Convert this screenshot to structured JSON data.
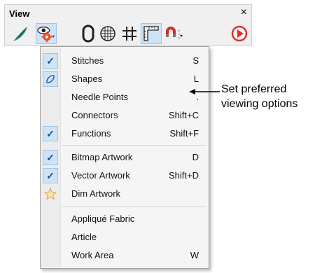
{
  "toolbar": {
    "title": "View",
    "close": "×",
    "buttons": [
      {
        "icon": "show-design-icon"
      },
      {
        "icon": "eye-gear-icon"
      },
      {
        "icon": "outline-shape-icon"
      },
      {
        "icon": "grid-globe-icon"
      },
      {
        "icon": "hash-grid-icon"
      },
      {
        "icon": "ruler-corner-icon"
      },
      {
        "icon": "magnet-icon"
      },
      {
        "icon": "play-record-icon"
      }
    ]
  },
  "menu": {
    "items": [
      {
        "label": "Stitches",
        "shortcut": "S",
        "icon": "check",
        "checked": true
      },
      {
        "label": "Shapes",
        "shortcut": "L",
        "icon": "shape-outline",
        "checked": true
      },
      {
        "label": "Needle Points",
        "shortcut": ".",
        "icon": "",
        "checked": false
      },
      {
        "label": "Connectors",
        "shortcut": "Shift+C",
        "icon": "",
        "checked": false
      },
      {
        "label": "Functions",
        "shortcut": "Shift+F",
        "icon": "check",
        "checked": true
      },
      {
        "label": "Bitmap Artwork",
        "shortcut": "D",
        "icon": "check",
        "checked": true
      },
      {
        "label": "Vector Artwork",
        "shortcut": "Shift+D",
        "icon": "check",
        "checked": true
      },
      {
        "label": "Dim Artwork",
        "shortcut": "",
        "icon": "dim-star",
        "checked": false
      },
      {
        "label": "Appliqué Fabric",
        "shortcut": "",
        "icon": "",
        "checked": false
      },
      {
        "label": "Article",
        "shortcut": "",
        "icon": "",
        "checked": false
      },
      {
        "label": "Work Area",
        "shortcut": "W",
        "icon": "",
        "checked": false
      }
    ]
  },
  "callout": {
    "line1": "Set preferred",
    "line2": "viewing options"
  },
  "colors": {
    "check": "#1b4f91",
    "highlight": "#cfe3f7",
    "leaf": "#1f8a7a",
    "gear": "#e8502a",
    "record": "#e0302a"
  }
}
